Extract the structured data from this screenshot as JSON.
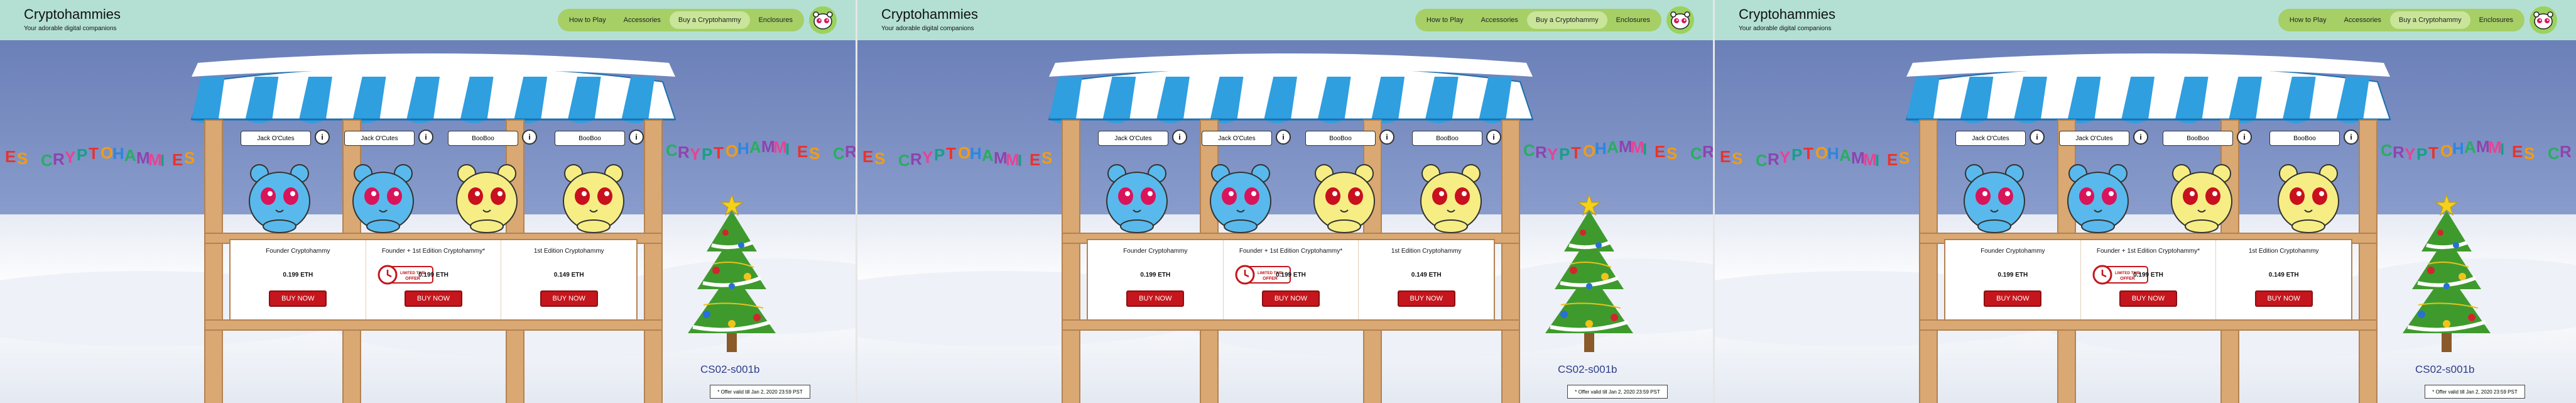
{
  "site": {
    "title": "Cryptohammies",
    "tagline": "Your adorable digital companions"
  },
  "nav": {
    "items": [
      "How to Play",
      "Accessories",
      "Buy a Cryptohammy",
      "Enclosures"
    ],
    "active_index": 2
  },
  "banner": {
    "text_panel1": "ES CRYPTOHAMMIES",
    "text_panel1_right": "CRYPTOHAMMIES CR",
    "text_panel2": "ES CRYPTOHAMMIES",
    "text_panel2_right": "CRYPTOHAMMIES CR",
    "text_panel3": "ES CRYPTOHAMMIES",
    "text_panel3_right": "CRYPTOHAMMIES CR"
  },
  "slots": [
    {
      "name": "Jack O'Cutes",
      "color": "blue",
      "info": "i"
    },
    {
      "name": "Jack O'Cutes",
      "color": "blue",
      "info": "i"
    },
    {
      "name": "BooBoo",
      "color": "yellow",
      "info": "i"
    },
    {
      "name": "BooBoo",
      "color": "yellow",
      "info": "i"
    }
  ],
  "offers": [
    {
      "title": "Founder Cryptohammy",
      "price": "0.199 ETH",
      "button": "BUY NOW"
    },
    {
      "title": "Founder + 1st Edition Cryptohammy*",
      "price": "0.199 ETH",
      "button": "BUY NOW",
      "badge": "LIMITED TIME OFFER"
    },
    {
      "title": "1st Edition Cryptohammy",
      "price": "0.149 ETH",
      "button": "BUY NOW"
    }
  ],
  "code": "CS02-s001b",
  "offer_note": "* Offer valid till Jan 2, 2020 23:59 PST",
  "colors": {
    "header_bg": "#b4e0d4",
    "nav_pill": "#a6cf66",
    "buy_button": "#c4161c",
    "awning_blue": "#2f9fe0",
    "wood": "#d9a873",
    "pet_blue": "#5ab9ec",
    "pet_yellow": "#f6ee85",
    "code_text": "#2d3d88"
  }
}
